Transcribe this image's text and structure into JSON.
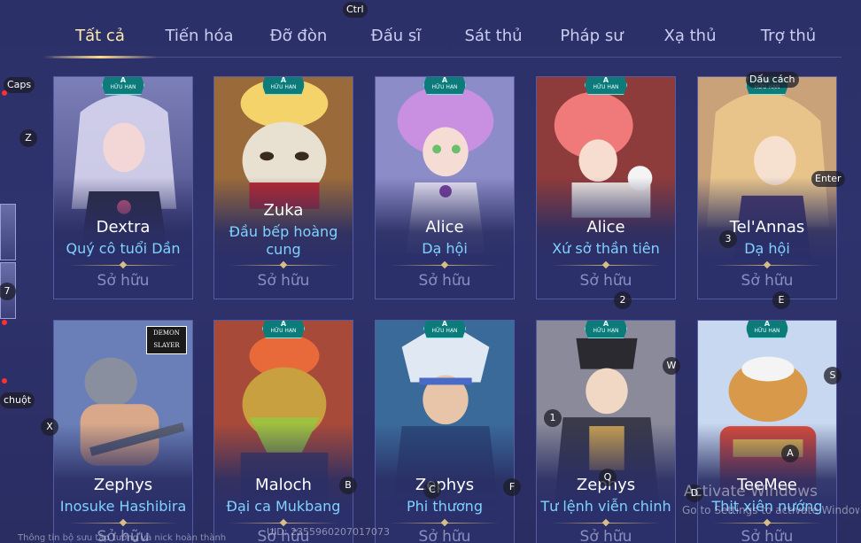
{
  "tabs": [
    {
      "label": "Tất cả",
      "active": true
    },
    {
      "label": "Tiến hóa",
      "active": false
    },
    {
      "label": "Đỡ đòn",
      "active": false
    },
    {
      "label": "Đấu sĩ",
      "active": false
    },
    {
      "label": "Sát thủ",
      "active": false
    },
    {
      "label": "Pháp sư",
      "active": false
    },
    {
      "label": "Xạ thủ",
      "active": false
    },
    {
      "label": "Trợ thủ",
      "active": false
    }
  ],
  "badge": {
    "rank": "A",
    "text": "HỮU HẠN"
  },
  "cards": [
    {
      "hero": "Dextra",
      "skin": "Quý cô tuổi Dần",
      "status": "Sở hữu"
    },
    {
      "hero": "Zuka",
      "skin": "Đầu bếp hoàng cung",
      "status": "Sở hữu"
    },
    {
      "hero": "Alice",
      "skin": "Dạ hội",
      "status": "Sở hữu"
    },
    {
      "hero": "Alice",
      "skin": "Xứ sở thần tiên",
      "status": "Sở hữu"
    },
    {
      "hero": "Tel'Annas",
      "skin": "Dạ hội",
      "status": "Sở hữu"
    },
    {
      "hero": "Zephys",
      "skin": "Inosuke Hashibira",
      "status": "Sở hữu",
      "logo": "DEMON SLAYER"
    },
    {
      "hero": "Maloch",
      "skin": "Đại ca Mukbang",
      "status": "Sở hữu"
    },
    {
      "hero": "Zephys",
      "skin": "Phi thương",
      "status": "Sở hữu"
    },
    {
      "hero": "Zephys",
      "skin": "Tư lệnh viễn chinh",
      "status": "Sở hữu"
    },
    {
      "hero": "TeeMee",
      "skin": "Thịt xiên nướng",
      "status": "Sở hữu"
    }
  ],
  "key_hints": {
    "ctrl": "Ctrl",
    "caps": "Caps",
    "z": "Z",
    "seven": "7",
    "chuot": "chuột",
    "x": "X",
    "dau_cach": "Dấu cách",
    "enter": "Enter",
    "three": "3",
    "two": "2",
    "e": "E",
    "w": "W",
    "s": "S",
    "one": "1",
    "q": "Q",
    "b": "B",
    "c": "C",
    "f": "F",
    "d": "D",
    "a": "A"
  },
  "watermarks": {
    "activate_title": "Activate Windows",
    "activate_sub": "Go to Settings to activate Windows.",
    "uid": "UID: 2355960207017073",
    "bottom_text": "Thông tin bộ sưu tập tướng và nick hoàn thành"
  },
  "colors": {
    "accent": "#ffd98a",
    "skin_text": "#7fd2ff",
    "badge": "#0e7b7b",
    "panel": "#2e3270"
  }
}
